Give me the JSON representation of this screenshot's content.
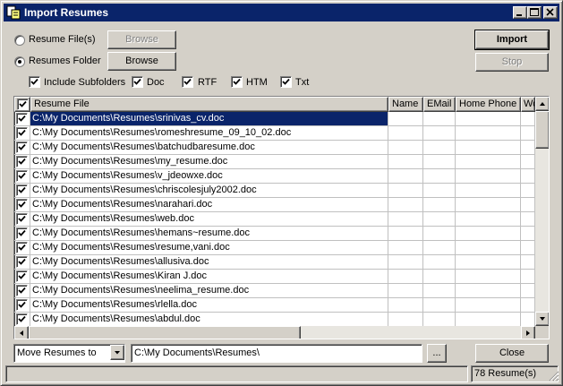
{
  "window": {
    "title": "Import Resumes",
    "title_bar_color": "#0a246a",
    "selection_color": "#0a246a"
  },
  "source": {
    "resume_files_label": "Resume File(s)",
    "resume_folder_label": "Resumes Folder",
    "browse_files_label": "Browse",
    "browse_folder_label": "Browse",
    "selected": "Resumes Folder"
  },
  "options": {
    "include_subfolders": "Include Subfolders",
    "doc": "Doc",
    "rtf": "RTF",
    "htm": "HTM",
    "txt": "Txt"
  },
  "actions": {
    "import_label": "Import",
    "stop_label": "Stop",
    "close_label": "Close"
  },
  "table": {
    "columns": [
      "Resume File",
      "Name",
      "EMail",
      "Home Phone",
      "Wo"
    ],
    "rows": [
      "C:\\My Documents\\Resumes\\srinivas_cv.doc",
      "C:\\My Documents\\Resumes\\romeshresume_09_10_02.doc",
      "C:\\My Documents\\Resumes\\batchudbaresume.doc",
      "C:\\My Documents\\Resumes\\my_resume.doc",
      "C:\\My Documents\\Resumes\\v_jdeowxe.doc",
      "C:\\My Documents\\Resumes\\chriscolesjuly2002.doc",
      "C:\\My Documents\\Resumes\\narahari.doc",
      "C:\\My Documents\\Resumes\\web.doc",
      "C:\\My Documents\\Resumes\\hemans~resume.doc",
      "C:\\My Documents\\Resumes\\resume,vani.doc",
      "C:\\My Documents\\Resumes\\allusiva.doc",
      "C:\\My Documents\\Resumes\\Kiran J.doc",
      "C:\\My Documents\\Resumes\\neelima_resume.doc",
      "C:\\My Documents\\Resumes\\rlella.doc",
      "C:\\My Documents\\Resumes\\abdul.doc"
    ]
  },
  "bottom": {
    "move_option": "Move Resumes to",
    "destination_path": "C:\\My Documents\\Resumes\\",
    "path_browse_label": "..."
  },
  "status": {
    "left": "",
    "count": "78 Resume(s)"
  }
}
